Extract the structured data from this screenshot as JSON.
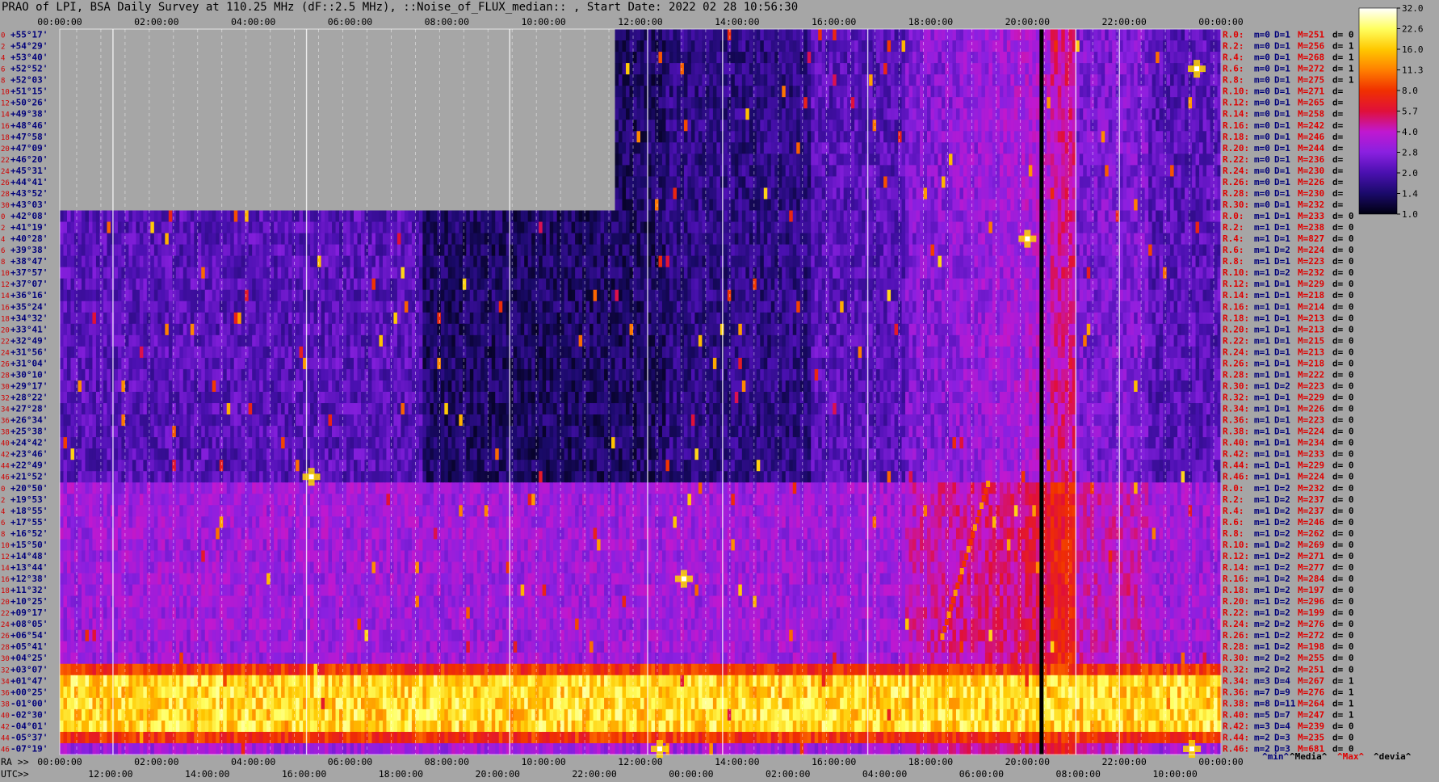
{
  "title": "PRAO of LPI, BSA Daily Survey at 110.25 MHz (dF::2.5 MHz), ::Noise_of_FLUX_median:: , Start Date: 2022 02 28 10:56:30",
  "chart_data": {
    "type": "heatmap",
    "title": "PRAO of LPI, BSA Daily Survey at 110.25 MHz (dF::2.5 MHz), ::Noise_of_FLUX_median:: , Start Date: 2022 02 28 10:56:30",
    "top_axis": {
      "ticks": [
        "00:00:00",
        "02:00:00",
        "04:00:00",
        "06:00:00",
        "08:00:00",
        "10:00:00",
        "12:00:00",
        "14:00:00",
        "16:00:00",
        "18:00:00",
        "20:00:00",
        "22:00:00",
        "00:00:00"
      ],
      "range_hours": [
        0,
        24
      ]
    },
    "bottom_axis": {
      "ra_prefix": "RA >>",
      "ra_ticks": [
        "00:00:00",
        "02:00:00",
        "04:00:00",
        "06:00:00",
        "08:00:00",
        "10:00:00",
        "12:00:00",
        "14:00:00",
        "16:00:00",
        "18:00:00",
        "20:00:00",
        "22:00:00",
        "00:00:00"
      ],
      "utc_prefix": "UTC>>",
      "utc_ticks": [
        "12:00:00",
        "14:00:00",
        "16:00:00",
        "18:00:00",
        "20:00:00",
        "22:00:00",
        "00:00:00",
        "02:00:00",
        "04:00:00",
        "06:00:00",
        "08:00:00",
        "10:00:00"
      ]
    },
    "declinations": [
      "+55°17'",
      "+54°29'",
      "+53°40'",
      "+52°52'",
      "+52°03'",
      "+51°15'",
      "+50°26'",
      "+49°38'",
      "+48°46'",
      "+47°58'",
      "+47°09'",
      "+46°20'",
      "+45°31'",
      "+44°41'",
      "+43°52'",
      "+43°03'",
      "+42°08'",
      "+41°19'",
      "+40°28'",
      "+39°38'",
      "+38°47'",
      "+37°57'",
      "+37°07'",
      "+36°16'",
      "+35°24'",
      "+34°32'",
      "+33°41'",
      "+32°49'",
      "+31°56'",
      "+31°04'",
      "+30°10'",
      "+29°17'",
      "+28°22'",
      "+27°28'",
      "+26°34'",
      "+25°38'",
      "+24°42'",
      "+23°46'",
      "+22°49'",
      "+21°52'",
      "+20°50'",
      "+19°53'",
      "+18°55'",
      "+17°55'",
      "+16°52'",
      "+15°50'",
      "+14°48'",
      "+13°44'",
      "+12°38'",
      "+11°32'",
      "+10°25'",
      "+09°17'",
      "+08°05'",
      "+06°54'",
      "+05°41'",
      "+04°25'",
      "+03°07'",
      "+01°47'",
      "+00°25'",
      "-01°00'",
      "-02°30'",
      "-04°01'",
      "-05°37'",
      "-07°19'"
    ],
    "row_indices": [
      "0",
      "2",
      "4",
      "6",
      "8",
      "10",
      "12",
      "14",
      "16",
      "18",
      "20",
      "22",
      "24",
      "26",
      "28",
      "30",
      "0",
      "2",
      "4",
      "6",
      "8",
      "10",
      "12",
      "14",
      "16",
      "18",
      "20",
      "22",
      "24",
      "26",
      "28",
      "30",
      "32",
      "34",
      "36",
      "38",
      "40",
      "42",
      "44",
      "46",
      "0",
      "2",
      "4",
      "6",
      "8",
      "10",
      "12",
      "14",
      "16",
      "18",
      "20",
      "22",
      "24",
      "26",
      "28",
      "30",
      "32",
      "34",
      "36",
      "38",
      "40",
      "42",
      "44",
      "46"
    ],
    "row_stats": [
      [
        "R.0:",
        "m=0",
        "D=1",
        "M=251",
        "d= 0"
      ],
      [
        "R.2:",
        "m=0",
        "D=1",
        "M=256",
        "d= 1"
      ],
      [
        "R.4:",
        "m=0",
        "D=1",
        "M=268",
        "d= 1"
      ],
      [
        "R.6:",
        "m=0",
        "D=1",
        "M=272",
        "d= 1"
      ],
      [
        "R.8:",
        "m=0",
        "D=1",
        "M=275",
        "d= 1"
      ],
      [
        "R.10:",
        "m=0",
        "D=1",
        "M=271",
        "d="
      ],
      [
        "R.12:",
        "m=0",
        "D=1",
        "M=265",
        "d="
      ],
      [
        "R.14:",
        "m=0",
        "D=1",
        "M=258",
        "d="
      ],
      [
        "R.16:",
        "m=0",
        "D=1",
        "M=242",
        "d="
      ],
      [
        "R.18:",
        "m=0",
        "D=1",
        "M=246",
        "d="
      ],
      [
        "R.20:",
        "m=0",
        "D=1",
        "M=244",
        "d="
      ],
      [
        "R.22:",
        "m=0",
        "D=1",
        "M=236",
        "d="
      ],
      [
        "R.24:",
        "m=0",
        "D=1",
        "M=230",
        "d="
      ],
      [
        "R.26:",
        "m=0",
        "D=1",
        "M=226",
        "d="
      ],
      [
        "R.28:",
        "m=0",
        "D=1",
        "M=230",
        "d="
      ],
      [
        "R.30:",
        "m=0",
        "D=1",
        "M=232",
        "d="
      ],
      [
        "R.0:",
        "m=1",
        "D=1",
        "M=233",
        "d= 0"
      ],
      [
        "R.2:",
        "m=1",
        "D=1",
        "M=238",
        "d= 0"
      ],
      [
        "R.4:",
        "m=1",
        "D=1",
        "M=827",
        "d= 0"
      ],
      [
        "R.6:",
        "m=1",
        "D=2",
        "M=224",
        "d= 0"
      ],
      [
        "R.8:",
        "m=1",
        "D=1",
        "M=223",
        "d= 0"
      ],
      [
        "R.10:",
        "m=1",
        "D=2",
        "M=232",
        "d= 0"
      ],
      [
        "R.12:",
        "m=1",
        "D=1",
        "M=229",
        "d= 0"
      ],
      [
        "R.14:",
        "m=1",
        "D=1",
        "M=218",
        "d= 0"
      ],
      [
        "R.16:",
        "m=1",
        "D=1",
        "M=214",
        "d= 0"
      ],
      [
        "R.18:",
        "m=1",
        "D=1",
        "M=213",
        "d= 0"
      ],
      [
        "R.20:",
        "m=1",
        "D=1",
        "M=213",
        "d= 0"
      ],
      [
        "R.22:",
        "m=1",
        "D=1",
        "M=215",
        "d= 0"
      ],
      [
        "R.24:",
        "m=1",
        "D=1",
        "M=213",
        "d= 0"
      ],
      [
        "R.26:",
        "m=1",
        "D=1",
        "M=218",
        "d= 0"
      ],
      [
        "R.28:",
        "m=1",
        "D=1",
        "M=222",
        "d= 0"
      ],
      [
        "R.30:",
        "m=1",
        "D=2",
        "M=223",
        "d= 0"
      ],
      [
        "R.32:",
        "m=1",
        "D=1",
        "M=229",
        "d= 0"
      ],
      [
        "R.34:",
        "m=1",
        "D=1",
        "M=226",
        "d= 0"
      ],
      [
        "R.36:",
        "m=1",
        "D=1",
        "M=223",
        "d= 0"
      ],
      [
        "R.38:",
        "m=1",
        "D=1",
        "M=224",
        "d= 0"
      ],
      [
        "R.40:",
        "m=1",
        "D=1",
        "M=234",
        "d= 0"
      ],
      [
        "R.42:",
        "m=1",
        "D=1",
        "M=233",
        "d= 0"
      ],
      [
        "R.44:",
        "m=1",
        "D=1",
        "M=229",
        "d= 0"
      ],
      [
        "R.46:",
        "m=1",
        "D=1",
        "M=224",
        "d= 0"
      ],
      [
        "R.0:",
        "m=1",
        "D=2",
        "M=232",
        "d= 0"
      ],
      [
        "R.2:",
        "m=1",
        "D=2",
        "M=237",
        "d= 0"
      ],
      [
        "R.4:",
        "m=1",
        "D=2",
        "M=237",
        "d= 0"
      ],
      [
        "R.6:",
        "m=1",
        "D=2",
        "M=246",
        "d= 0"
      ],
      [
        "R.8:",
        "m=1",
        "D=2",
        "M=262",
        "d= 0"
      ],
      [
        "R.10:",
        "m=1",
        "D=2",
        "M=269",
        "d= 0"
      ],
      [
        "R.12:",
        "m=1",
        "D=2",
        "M=271",
        "d= 0"
      ],
      [
        "R.14:",
        "m=1",
        "D=2",
        "M=277",
        "d= 0"
      ],
      [
        "R.16:",
        "m=1",
        "D=2",
        "M=284",
        "d= 0"
      ],
      [
        "R.18:",
        "m=1",
        "D=2",
        "M=197",
        "d= 0"
      ],
      [
        "R.20:",
        "m=1",
        "D=2",
        "M=296",
        "d= 0"
      ],
      [
        "R.22:",
        "m=1",
        "D=2",
        "M=199",
        "d= 0"
      ],
      [
        "R.24:",
        "m=2",
        "D=2",
        "M=276",
        "d= 0"
      ],
      [
        "R.26:",
        "m=1",
        "D=2",
        "M=272",
        "d= 0"
      ],
      [
        "R.28:",
        "m=1",
        "D=2",
        "M=198",
        "d= 0"
      ],
      [
        "R.30:",
        "m=2",
        "D=2",
        "M=255",
        "d= 0"
      ],
      [
        "R.32:",
        "m=2",
        "D=2",
        "M=251",
        "d= 0"
      ],
      [
        "R.34:",
        "m=3",
        "D=4",
        "M=267",
        "d= 1"
      ],
      [
        "R.36:",
        "m=7",
        "D=9",
        "M=276",
        "d= 1"
      ],
      [
        "R.38:",
        "m=8",
        "D=11",
        "M=264",
        "d= 1"
      ],
      [
        "R.40:",
        "m=5",
        "D=7",
        "M=247",
        "d= 1"
      ],
      [
        "R.42:",
        "m=3",
        "D=4",
        "M=239",
        "d= 0"
      ],
      [
        "R.44:",
        "m=2",
        "D=3",
        "M=235",
        "d= 0"
      ],
      [
        "R.46:",
        "m=2",
        "D=3",
        "M=681",
        "d= 0"
      ]
    ],
    "stat_footer": [
      "^min^",
      "^Media^",
      "^Max^",
      "^devia^"
    ],
    "colorbar": {
      "ticks": [
        "32.0",
        "22.6",
        "16.0",
        "11.3",
        "8.0",
        "5.7",
        "4.0",
        "2.8",
        "2.0",
        "1.4",
        "1.0"
      ],
      "range": [
        1.0,
        32.0
      ],
      "scale": "log2",
      "colors": [
        "#000010",
        "#1a0a6a",
        "#4a10b0",
        "#8a20e0",
        "#c018d0",
        "#e0103a",
        "#f03000",
        "#ff8000",
        "#ffc800",
        "#ffff60",
        "#ffffff"
      ]
    },
    "missing_data": {
      "rows_from_index": 0,
      "rows_count": 16,
      "hours": [
        0,
        11.5
      ]
    },
    "features": {
      "bright_band_declinations": [
        "+01°47'",
        "-04°01'"
      ],
      "sources": [
        {
          "ra_hours": 20.0,
          "dec": "+40°28'"
        },
        {
          "ra_hours": 5.2,
          "dec": "+21°52'"
        },
        {
          "ra_hours": 12.4,
          "dec": "-07°19'"
        },
        {
          "ra_hours": 23.4,
          "dec": "-07°19'"
        },
        {
          "ra_hours": 12.9,
          "dec": "+12°38'"
        },
        {
          "ra_hours": 23.5,
          "dec": "+52°52'"
        }
      ]
    }
  }
}
